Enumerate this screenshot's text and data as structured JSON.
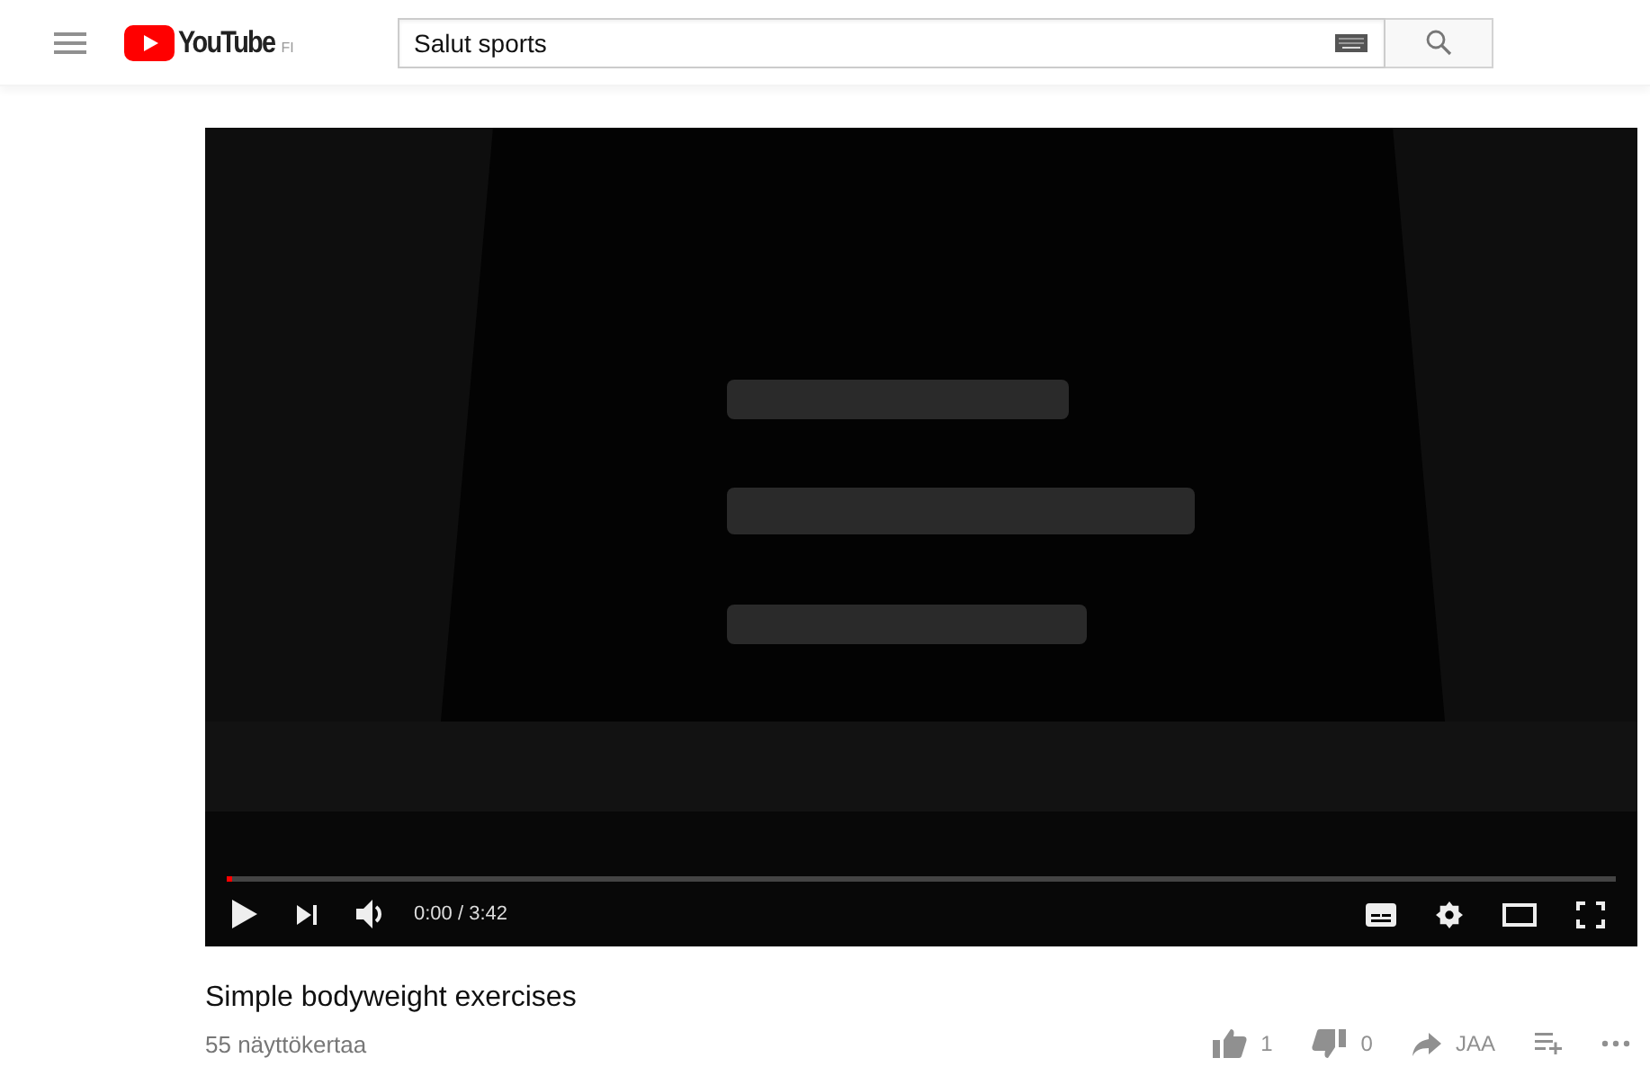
{
  "header": {
    "logo_text": "YouTube",
    "region": "FI",
    "search": {
      "value": "Salut sports"
    }
  },
  "player": {
    "kind": "picture",
    "progress": {
      "level": 0.004
    },
    "time": "0:00 / 3:42"
  },
  "video": {
    "title": "Simple bodyweight exercises",
    "views": "55 näyttökertaa",
    "actions": [
      {
        "kind": "like",
        "label": "1"
      },
      {
        "kind": "dislike",
        "label": "0"
      },
      {
        "kind": "share",
        "label": "JAA"
      },
      {
        "kind": "add"
      },
      {
        "kind": "more"
      }
    ]
  }
}
